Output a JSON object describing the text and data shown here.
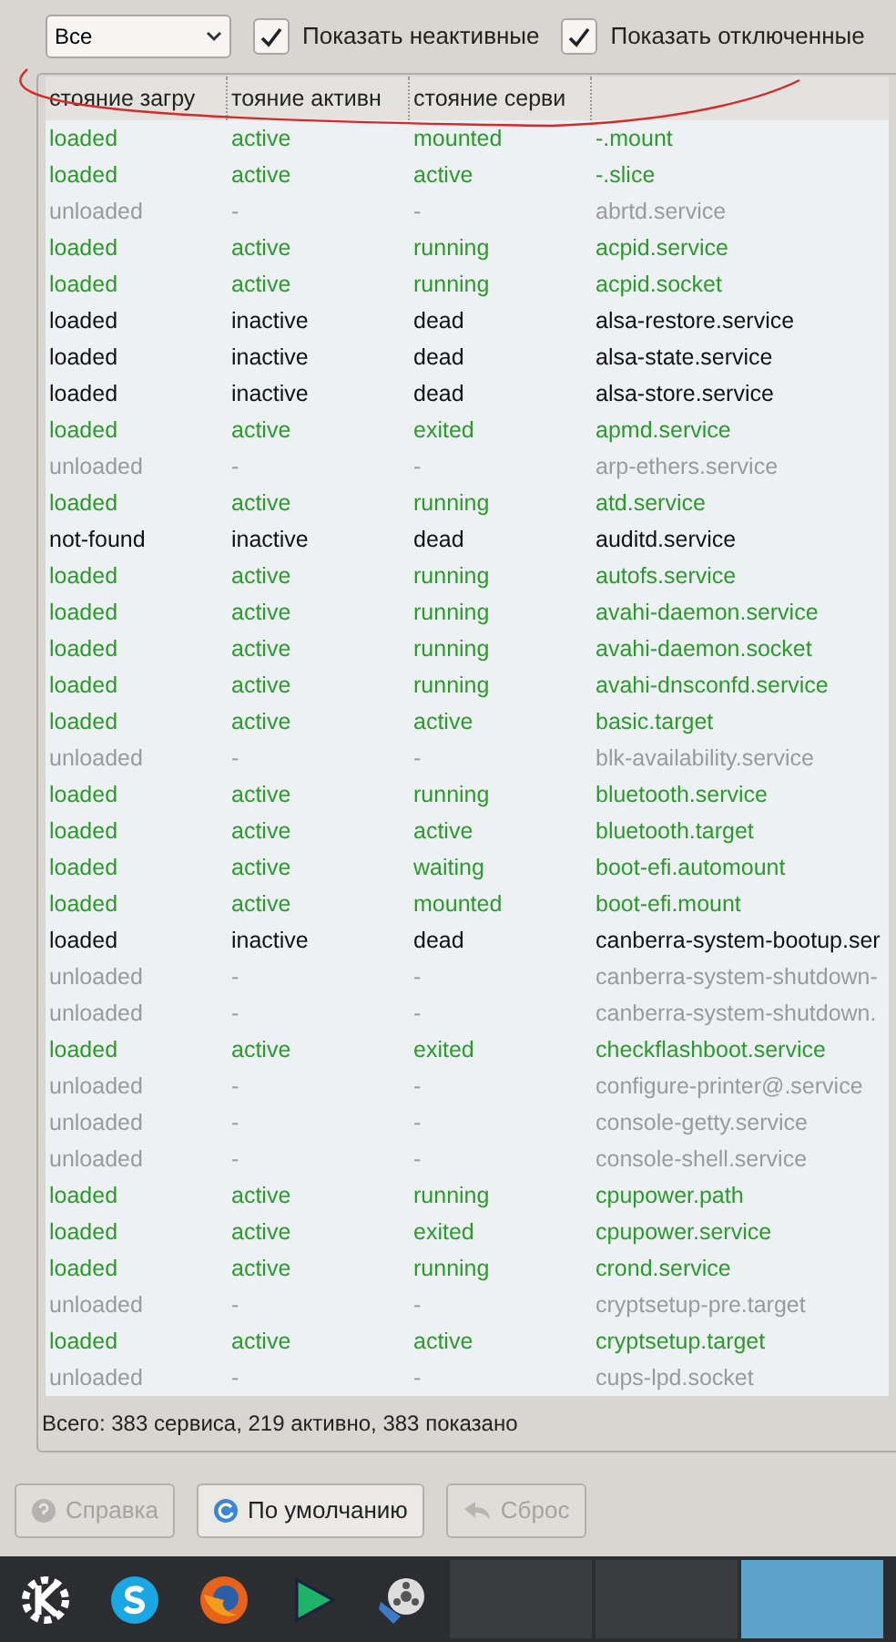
{
  "filter": {
    "value": "Все"
  },
  "checkboxes": [
    {
      "label": "Показать неактивные",
      "checked": true
    },
    {
      "label": "Показать отключенные",
      "checked": true
    }
  ],
  "table": {
    "columns": [
      "стояние загру",
      "тояние активн",
      "стояние серви"
    ],
    "rows": [
      {
        "kind": "active",
        "cells": [
          "loaded",
          "active",
          "mounted",
          "-.mount"
        ]
      },
      {
        "kind": "active",
        "cells": [
          "loaded",
          "active",
          "active",
          "-.slice"
        ]
      },
      {
        "kind": "unloaded",
        "cells": [
          "unloaded",
          "-",
          "-",
          "abrtd.service"
        ]
      },
      {
        "kind": "active",
        "cells": [
          "loaded",
          "active",
          "running",
          "acpid.service"
        ]
      },
      {
        "kind": "active",
        "cells": [
          "loaded",
          "active",
          "running",
          "acpid.socket"
        ]
      },
      {
        "kind": "inactive",
        "cells": [
          "loaded",
          "inactive",
          "dead",
          "alsa-restore.service"
        ]
      },
      {
        "kind": "inactive",
        "cells": [
          "loaded",
          "inactive",
          "dead",
          "alsa-state.service"
        ]
      },
      {
        "kind": "inactive",
        "cells": [
          "loaded",
          "inactive",
          "dead",
          "alsa-store.service"
        ]
      },
      {
        "kind": "active",
        "cells": [
          "loaded",
          "active",
          "exited",
          "apmd.service"
        ]
      },
      {
        "kind": "unloaded",
        "cells": [
          "unloaded",
          "-",
          "-",
          "arp-ethers.service"
        ]
      },
      {
        "kind": "active",
        "cells": [
          "loaded",
          "active",
          "running",
          "atd.service"
        ]
      },
      {
        "kind": "inactive",
        "cells": [
          "not-found",
          "inactive",
          "dead",
          "auditd.service"
        ]
      },
      {
        "kind": "active",
        "cells": [
          "loaded",
          "active",
          "running",
          "autofs.service"
        ]
      },
      {
        "kind": "active",
        "cells": [
          "loaded",
          "active",
          "running",
          "avahi-daemon.service"
        ]
      },
      {
        "kind": "active",
        "cells": [
          "loaded",
          "active",
          "running",
          "avahi-daemon.socket"
        ]
      },
      {
        "kind": "active",
        "cells": [
          "loaded",
          "active",
          "running",
          "avahi-dnsconfd.service"
        ]
      },
      {
        "kind": "active",
        "cells": [
          "loaded",
          "active",
          "active",
          "basic.target"
        ]
      },
      {
        "kind": "unloaded",
        "cells": [
          "unloaded",
          "-",
          "-",
          "blk-availability.service"
        ]
      },
      {
        "kind": "active",
        "cells": [
          "loaded",
          "active",
          "running",
          "bluetooth.service"
        ]
      },
      {
        "kind": "active",
        "cells": [
          "loaded",
          "active",
          "active",
          "bluetooth.target"
        ]
      },
      {
        "kind": "active",
        "cells": [
          "loaded",
          "active",
          "waiting",
          "boot-efi.automount"
        ]
      },
      {
        "kind": "active",
        "cells": [
          "loaded",
          "active",
          "mounted",
          "boot-efi.mount"
        ]
      },
      {
        "kind": "inactive",
        "cells": [
          "loaded",
          "inactive",
          "dead",
          "canberra-system-bootup.ser"
        ]
      },
      {
        "kind": "unloaded",
        "cells": [
          "unloaded",
          "-",
          "-",
          "canberra-system-shutdown-"
        ]
      },
      {
        "kind": "unloaded",
        "cells": [
          "unloaded",
          "-",
          "-",
          "canberra-system-shutdown."
        ]
      },
      {
        "kind": "active",
        "cells": [
          "loaded",
          "active",
          "exited",
          "checkflashboot.service"
        ]
      },
      {
        "kind": "unloaded",
        "cells": [
          "unloaded",
          "-",
          "-",
          "configure-printer@.service"
        ]
      },
      {
        "kind": "unloaded",
        "cells": [
          "unloaded",
          "-",
          "-",
          "console-getty.service"
        ]
      },
      {
        "kind": "unloaded",
        "cells": [
          "unloaded",
          "-",
          "-",
          "console-shell.service"
        ]
      },
      {
        "kind": "active",
        "cells": [
          "loaded",
          "active",
          "running",
          "cpupower.path"
        ]
      },
      {
        "kind": "active",
        "cells": [
          "loaded",
          "active",
          "exited",
          "cpupower.service"
        ]
      },
      {
        "kind": "active",
        "cells": [
          "loaded",
          "active",
          "running",
          "crond.service"
        ]
      },
      {
        "kind": "unloaded",
        "cells": [
          "unloaded",
          "-",
          "-",
          "cryptsetup-pre.target"
        ]
      },
      {
        "kind": "active",
        "cells": [
          "loaded",
          "active",
          "active",
          "cryptsetup.target"
        ]
      },
      {
        "kind": "unloaded",
        "cells": [
          "unloaded",
          "-",
          "-",
          "cups-lpd.socket"
        ]
      }
    ]
  },
  "summary": "Всего: 383 сервиса, 219 активно, 383 показано",
  "buttons": [
    {
      "label": "Справка",
      "disabled": true
    },
    {
      "label": "По умолчанию",
      "disabled": false
    },
    {
      "label": "Сброс",
      "disabled": true
    }
  ],
  "taskbar": [
    {
      "kind": "kde"
    },
    {
      "kind": "skype"
    },
    {
      "kind": "firefox"
    },
    {
      "kind": "play"
    },
    {
      "kind": "film"
    },
    {
      "kind": "task",
      "selected": false
    },
    {
      "kind": "task",
      "selected": false
    },
    {
      "kind": "task",
      "selected": true
    }
  ]
}
